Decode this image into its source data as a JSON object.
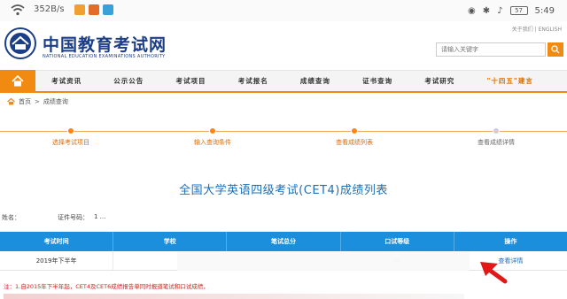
{
  "status_bar": {
    "net_speed": "352B/s",
    "battery_level": "57",
    "time": "5:49"
  },
  "header": {
    "site_title": "中国教育考试网",
    "site_subtitle": "NATIONAL EDUCATION EXAMINATIONS AUTHORITY",
    "top_links": "关于我们 | ENGLISH",
    "search": {
      "placeholder": "请输入关键字"
    }
  },
  "nav": {
    "items": [
      "考试资讯",
      "公示公告",
      "考试项目",
      "考试报名",
      "成绩查询",
      "证书查询",
      "考试研究",
      "\"十四五\"建言"
    ]
  },
  "breadcrumb": {
    "home": "首页",
    "separator": ">",
    "current": "成绩查询"
  },
  "steps": [
    {
      "label": "选择考试项目",
      "done": true
    },
    {
      "label": "输入查询条件",
      "done": true
    },
    {
      "label": "查看成绩列表",
      "done": true
    },
    {
      "label": "查看成绩详情",
      "done": false
    }
  ],
  "page_title": "全国大学英语四级考试(CET4)成绩列表",
  "info": {
    "name_label": "姓名：",
    "id_label": "证件号码：",
    "id_value": "1 ..."
  },
  "table": {
    "headers": [
      "考试时间",
      "学校",
      "笔试总分",
      "口试等级",
      "操作"
    ],
    "rows": [
      {
        "time": "2019年下半年",
        "school": "",
        "score": "",
        "oral": "--",
        "action": "查看详情"
      }
    ]
  },
  "note": "注：1.自2015年下半年起，CET4及CET6成绩报告单同时报道笔试和口试成绩，",
  "colors": {
    "accent": "#f08a10",
    "brand_blue": "#1c3e87",
    "table_header": "#1b8fdc",
    "title_blue": "#1b6fb8"
  }
}
